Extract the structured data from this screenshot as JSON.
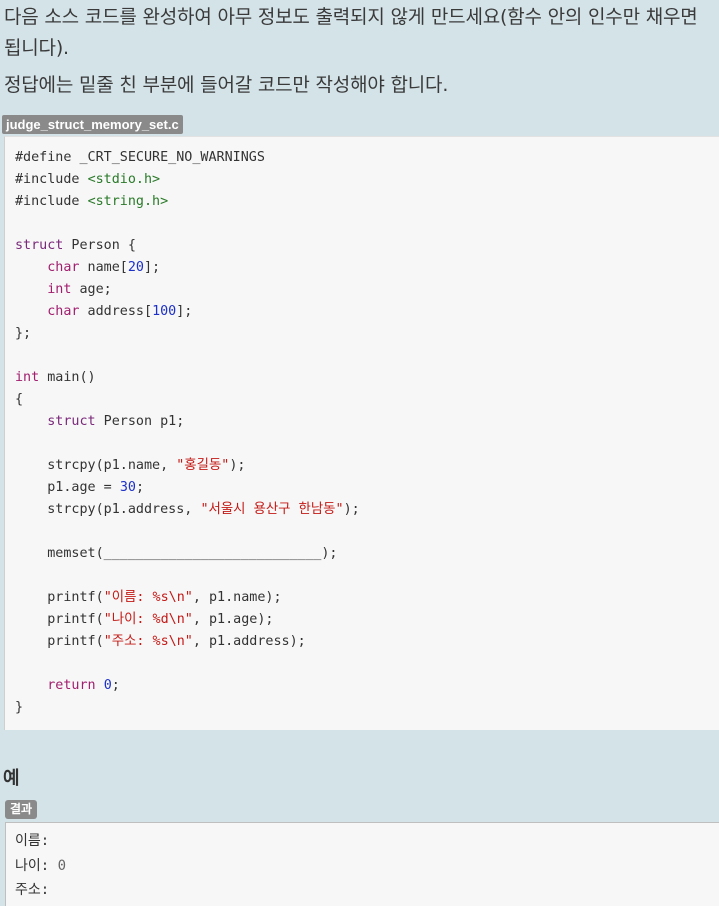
{
  "intro": {
    "line1": "다음 소스 코드를 완성하여 아무 정보도 출력되지 않게 만드세요(함수 안의 인수만 채우면 됩니다).",
    "line2": "정답에는 밑줄 친 부분에 들어갈 코드만 작성해야 합니다."
  },
  "file_tag": "judge_struct_memory_set.c",
  "code": {
    "l1": "#define _CRT_SECURE_NO_WARNINGS",
    "inc_kw": "#include ",
    "inc1": "<stdio.h>",
    "inc2": "<string.h>",
    "struct_kw": "struct",
    "struct_name": " Person {",
    "char_kw": "char",
    "int_kw": "int",
    "name_field": " name[",
    "name_size": "20",
    "field_end": "];",
    "age_field": " age;",
    "address_field": " address[",
    "address_size": "100",
    "struct_close": "};",
    "main_sig": " main()",
    "open_brace": "{",
    "close_brace": "}",
    "decl_rest": " Person p1;",
    "strcpy_name_pre": "strcpy(p1.name, ",
    "strcpy_name_str": "\"홍길동\"",
    "strcpy_end": ");",
    "age_assign_pre": "p1.age = ",
    "age_value": "30",
    "semicolon": ";",
    "strcpy_addr_pre": "strcpy(p1.address, ",
    "strcpy_addr_str": "\"서울시 용산구 한남동\"",
    "memset_line": "memset(___________________________);",
    "printf_open": "printf(",
    "printf1_str": "\"이름: %s\\n\"",
    "printf1_rest": ", p1.name);",
    "printf2_str": "\"나이: %d\\n\"",
    "printf2_rest": ", p1.age);",
    "printf3_str": "\"주소: %s\\n\"",
    "printf3_rest": ", p1.address);",
    "return_kw": "return",
    "return_space": " ",
    "return_value": "0"
  },
  "example": {
    "heading": "예",
    "result_tag": "결과",
    "line1": "이름:",
    "line2_label": "나이: ",
    "line2_value": "0",
    "line3": "주소:"
  },
  "colors": {
    "background": "#d4e3e8",
    "code_background": "#f7f7f7",
    "keyword": "#a11e6e",
    "include_path": "#2a7a2a",
    "number": "#1d30c8",
    "string": "#c41a16"
  }
}
